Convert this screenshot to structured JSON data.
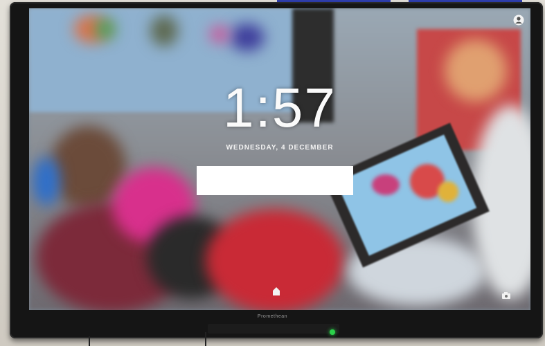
{
  "lock_screen": {
    "time": "1:57",
    "date": "WEDNESDAY, 4 DECEMBER",
    "password_value": "",
    "icons": {
      "account": "account-circle-icon",
      "home": "home-icon",
      "camera": "camera-icon"
    }
  },
  "monitor": {
    "brand": "Promethean"
  },
  "colors": {
    "bezel": "#151515",
    "clock_text": "#fafafa",
    "power_led": "#2bd14a"
  }
}
